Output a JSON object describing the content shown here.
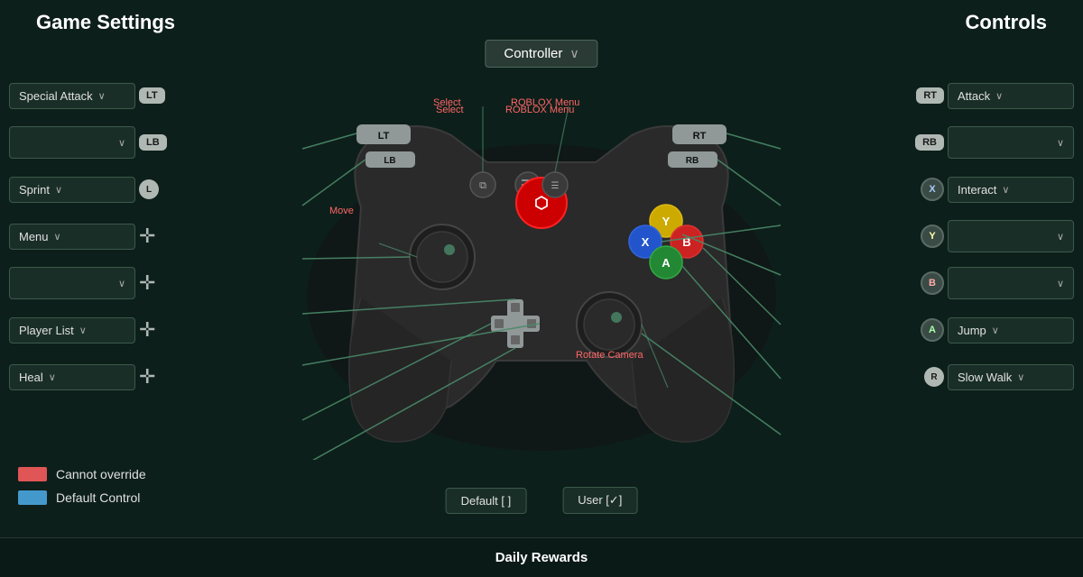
{
  "header": {
    "left_title": "Game Settings",
    "right_title": "Controls"
  },
  "controller_dropdown": {
    "label": "Controller",
    "chevron": "∨"
  },
  "left_controls": [
    {
      "label": "Special Attack",
      "icon": "LT",
      "icon_type": "trigger"
    },
    {
      "label": "",
      "icon": "LB",
      "icon_type": "trigger"
    },
    {
      "label": "Sprint",
      "icon": "L",
      "icon_type": "stick"
    },
    {
      "label": "Menu",
      "icon": "dpad_up",
      "icon_type": "dpad"
    },
    {
      "label": "",
      "icon": "dpad_right",
      "icon_type": "dpad"
    },
    {
      "label": "Player List",
      "icon": "dpad_left",
      "icon_type": "dpad"
    },
    {
      "label": "Heal",
      "icon": "dpad_down",
      "icon_type": "dpad"
    }
  ],
  "right_controls": [
    {
      "label": "Attack",
      "icon": "RT",
      "icon_type": "trigger"
    },
    {
      "label": "",
      "icon": "RB",
      "icon_type": "trigger"
    },
    {
      "label": "Interact",
      "icon": "X",
      "icon_type": "face"
    },
    {
      "label": "",
      "icon": "Y",
      "icon_type": "face"
    },
    {
      "label": "",
      "icon": "B",
      "icon_type": "face"
    },
    {
      "label": "Jump",
      "icon": "A",
      "icon_type": "face"
    },
    {
      "label": "Slow Walk",
      "icon": "R",
      "icon_type": "stick"
    }
  ],
  "labels": {
    "select": "Select",
    "roblox_menu": "ROBLOX Menu",
    "move": "Move",
    "rotate_camera": "Rotate Camera"
  },
  "legend": {
    "cannot_override": {
      "color": "#e05555",
      "text": "Cannot override"
    },
    "default_control": {
      "color": "#4499cc",
      "text": "Default Control"
    }
  },
  "bottom_buttons": {
    "default_label": "Default [ ]",
    "user_label": "User [✓]"
  },
  "footer": {
    "daily_rewards": "Daily Rewards"
  }
}
